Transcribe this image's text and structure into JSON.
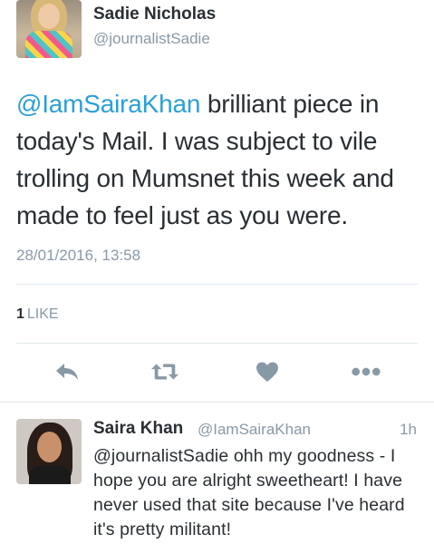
{
  "tweet": {
    "author_name": "Sadie Nicholas",
    "author_handle": "@journalistSadie",
    "mention": "@IamSairaKhan",
    "text": " brilliant piece in today's Mail. I was subject to vile trolling on Mumsnet this week and made to feel just as you were.",
    "timestamp": "28/01/2016, 13:58",
    "like_count": "1",
    "like_label": "LIKE",
    "actions": {
      "reply_icon": "reply-icon",
      "retweet_icon": "retweet-icon",
      "like_icon": "heart-icon",
      "more_icon": "more-dots-icon"
    }
  },
  "reply": {
    "author_name": "Saira Khan",
    "author_handle": "@IamSairaKhan",
    "time": "1h",
    "text": "@journalistSadie ohh my goodness - I hope you are alright sweetheart! I have never used that site because I've heard it's pretty militant!"
  },
  "colors": {
    "link": "#2b9fd9",
    "text": "#292f33",
    "muted": "#8899a6",
    "icon": "#8899a6",
    "divider": "#e1e8ed"
  }
}
